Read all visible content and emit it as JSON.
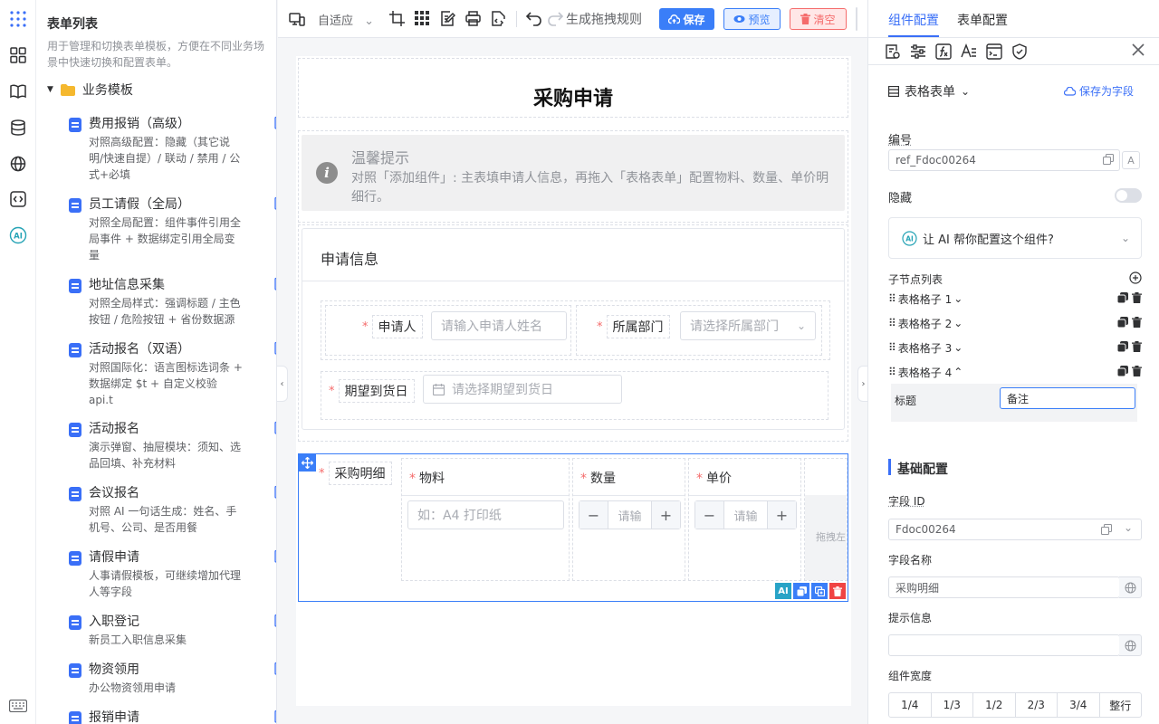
{
  "template_panel": {
    "title": "表单列表",
    "description": "用于管理和切换表单模板，方便在不同业务场景中快速切换和配置表单。",
    "group_label": "业务模板",
    "items": [
      {
        "name": "费用报销（高级）",
        "desc": "对照高级配置：隐藏（其它说明/快速自提）/ 联动 / 禁用 / 公式+必填"
      },
      {
        "name": "员工请假（全局）",
        "desc": "对照全局配置：组件事件引用全局事件 + 数据绑定引用全局变量"
      },
      {
        "name": "地址信息采集",
        "desc": "对照全局样式：强调标题 / 主色按钮 / 危险按钮 + 省份数据源"
      },
      {
        "name": "活动报名（双语）",
        "desc": "对照国际化：语言图标选词条 + 数据绑定 $t + 自定义校验 api.t"
      },
      {
        "name": "活动报名",
        "desc": "演示弹窗、抽屉模块：须知、选品回填、补充材料"
      },
      {
        "name": "会议报名",
        "desc": "对照 AI 一句话生成：姓名、手机号、公司、是否用餐"
      },
      {
        "name": "请假申请",
        "desc": "人事请假模板，可继续增加代理人等字段"
      },
      {
        "name": "入职登记",
        "desc": "新员工入职信息采集"
      },
      {
        "name": "物资领用",
        "desc": "办公物资领用申请"
      },
      {
        "name": "报销申请",
        "desc": ""
      }
    ]
  },
  "toolbar": {
    "fit_label": "自适应",
    "gen_rule_label": "生成拖拽规则",
    "save_label": "保存",
    "preview_label": "预览",
    "clear_label": "清空",
    "colors": {
      "save": "#3a7ef8",
      "preview_bg": "#e6efff",
      "clear_bg": "#ffe7e7",
      "clear_text": "#f56c6c"
    }
  },
  "canvas": {
    "form_title": "采购申请",
    "tip_title": "温馨提示",
    "tip_text": "对照「添加组件」: 主表填申请人信息，再拖入「表格表单」配置物料、数量、单价明细行。",
    "section_title": "申请信息",
    "fields": {
      "applicant_label": "申请人",
      "applicant_placeholder": "请输入申请人姓名",
      "dept_label": "所属部门",
      "dept_placeholder": "请选择所属部门",
      "date_label": "期望到货日",
      "date_placeholder": "请选择期望到货日"
    },
    "detail_table": {
      "label": "采购明细",
      "col_material": "物料",
      "col_qty": "数量",
      "col_price": "单价",
      "material_placeholder": "如：A4 打印纸",
      "qty_placeholder": "请输",
      "price_placeholder": "请输",
      "drag_hint": "拖拽左"
    }
  },
  "right_panel": {
    "tab_component": "组件配置",
    "tab_form": "表单配置",
    "component_type": "表格表单",
    "save_as_field": "保存为字段",
    "ref_label": "编号",
    "ref_value": "ref_Fdoc00264",
    "hidden_label": "隐藏",
    "ai_prompt": "让 AI 帮你配置这个组件?",
    "child_list_label": "子节点列表",
    "children": [
      {
        "label": "表格格子 1"
      },
      {
        "label": "表格格子 2"
      },
      {
        "label": "表格格子 3"
      },
      {
        "label": "表格格子 4"
      }
    ],
    "child_title_label": "标题",
    "child_title_value": "备注",
    "basic_config": "基础配置",
    "field_id_label": "字段 ID",
    "field_id_value": "Fdoc00264",
    "field_name_label": "字段名称",
    "field_name_value": "采购明细",
    "hint_label": "提示信息",
    "hint_value": "",
    "width_label": "组件宽度",
    "widths": [
      "1/4",
      "1/3",
      "1/2",
      "2/3",
      "3/4",
      "整行"
    ]
  }
}
